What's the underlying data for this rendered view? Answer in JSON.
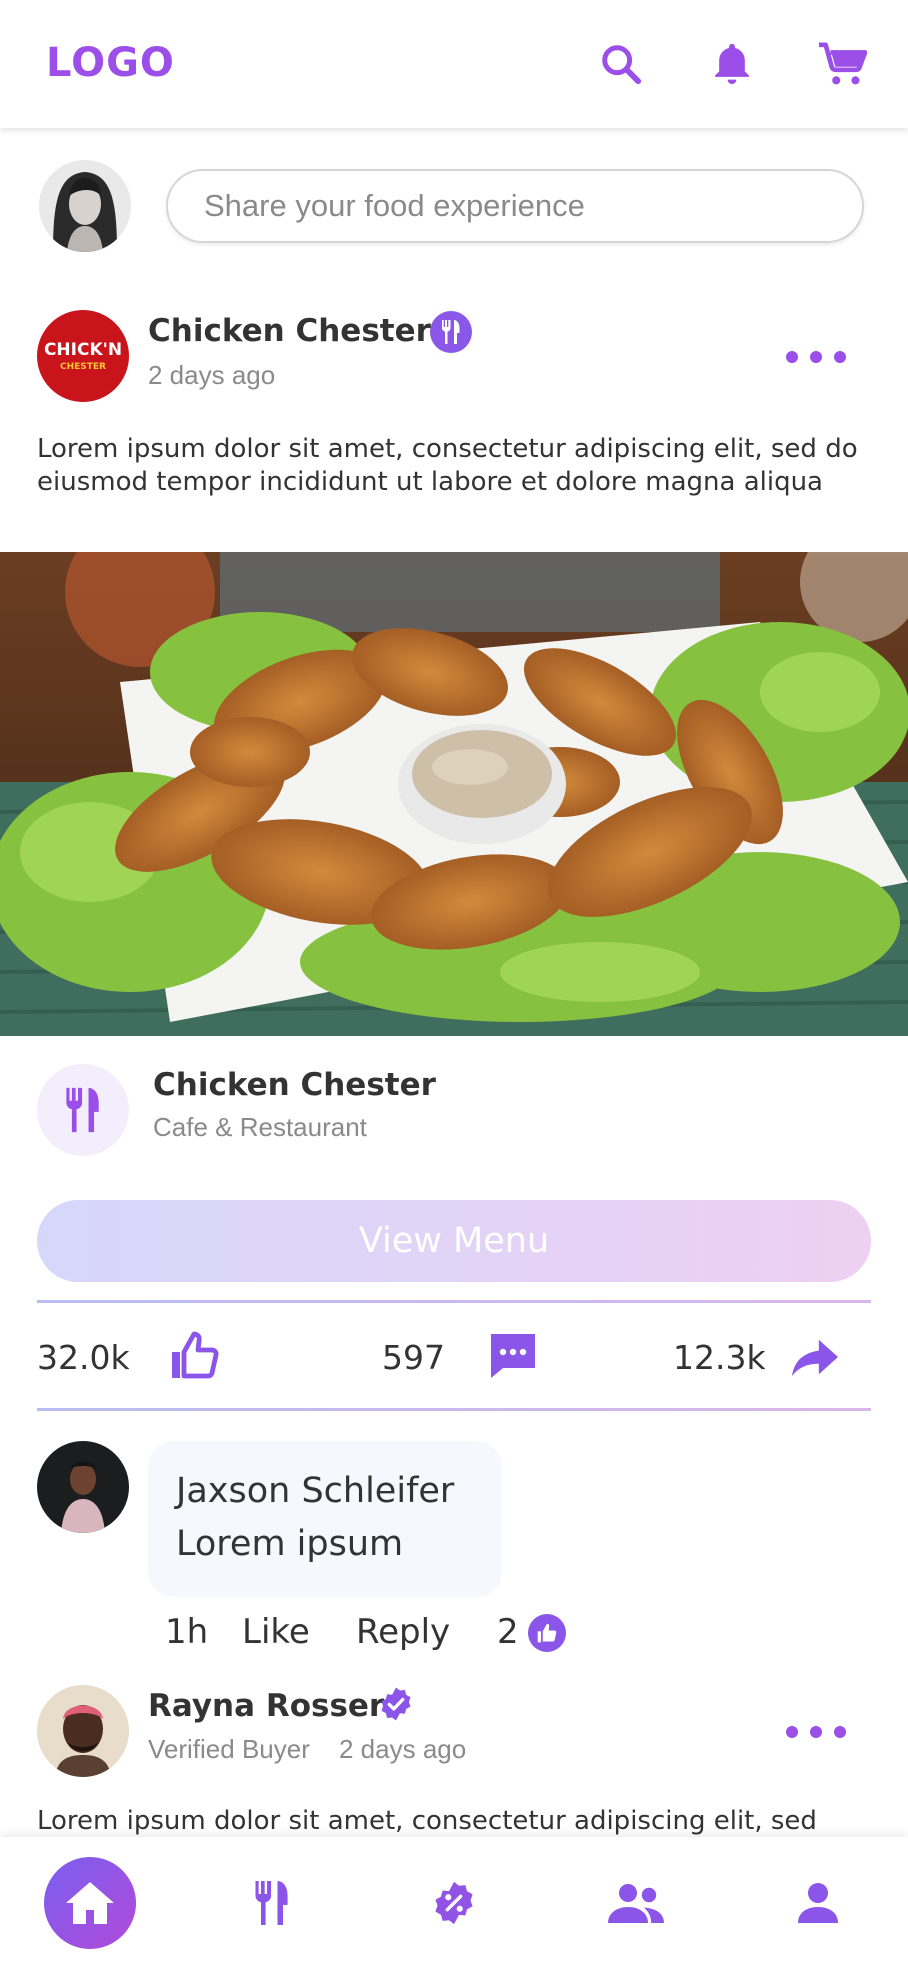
{
  "header": {
    "logo": "LOGO",
    "icons": [
      "search-icon",
      "bell-icon",
      "cart-icon"
    ],
    "accent": "#9b4ee8"
  },
  "composer": {
    "placeholder": "Share your food experience"
  },
  "post": {
    "author": "Chicken Chester",
    "avatar_text_1": "CHICK'N",
    "avatar_text_2": "CHESTER",
    "time": "2 days ago",
    "body": "Lorem ipsum dolor sit amet, consectetur adipiscing elit, sed do eiusmod tempor incididunt ut labore et dolore magna aliqua",
    "place": {
      "name": "Chicken Chester",
      "category": "Cafe & Restaurant"
    },
    "view_menu_label": "View Menu",
    "stats": {
      "likes": "32.0k",
      "comments": "597",
      "shares": "12.3k"
    }
  },
  "comment": {
    "author": "Jaxson Schleifer",
    "text": "Lorem ipsum",
    "time": "1h",
    "like_label": "Like",
    "reply_label": "Reply",
    "like_count": "2"
  },
  "post2": {
    "author": "Rayna Rosser",
    "badge": "Verified Buyer",
    "time": "2 days ago",
    "body": "Lorem ipsum dolor sit amet, consectetur adipiscing elit, sed"
  },
  "bottom_nav": [
    "home-icon",
    "restaurant-icon",
    "discount-icon",
    "community-icon",
    "profile-icon"
  ]
}
